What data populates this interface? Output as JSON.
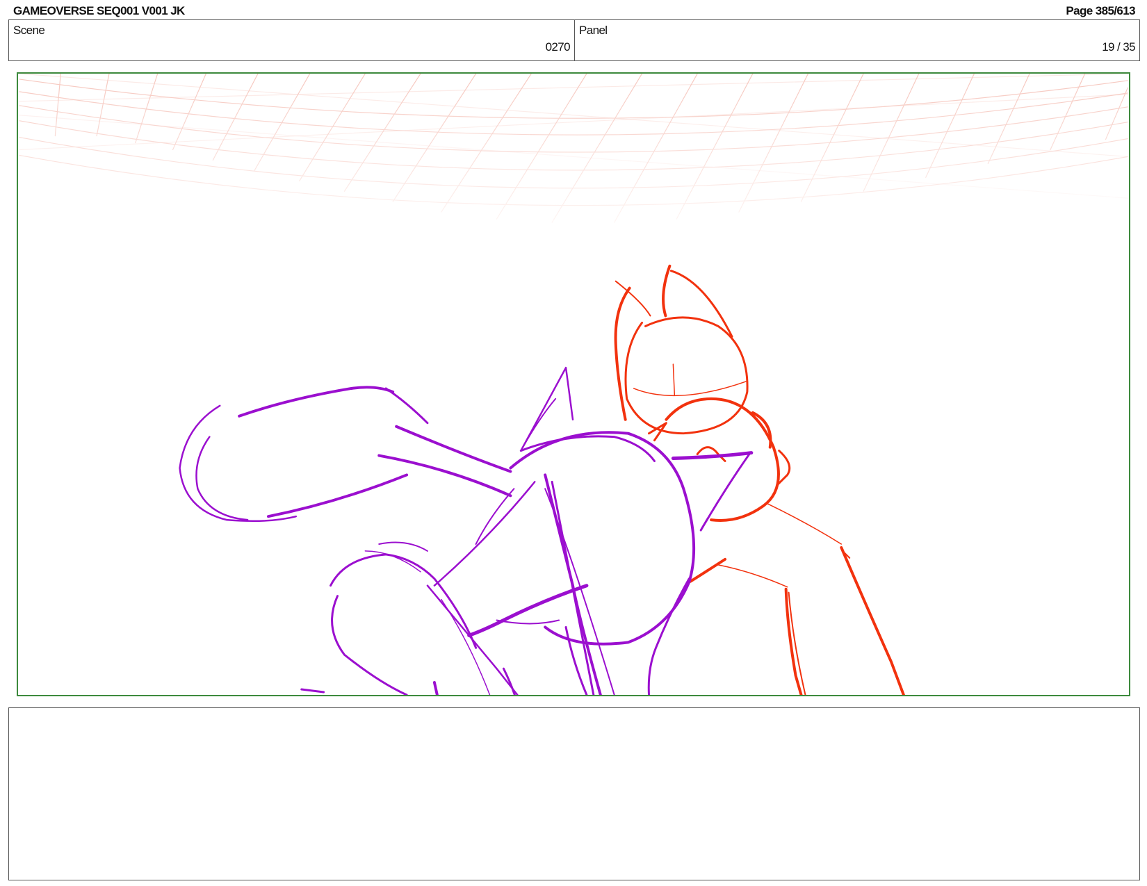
{
  "header": {
    "title": "GAMEOVERSE SEQ001 V001 JK",
    "page": "Page 385/613"
  },
  "info": {
    "scene_label": "Scene",
    "scene_value": "0270",
    "panel_label": "Panel",
    "panel_value": "19 / 35"
  },
  "colors": {
    "frame_border": "#3d8a3d",
    "sketch_purple": "#9b0fcf",
    "sketch_red": "#f2320e",
    "grid_pink": "#f3b4a8"
  },
  "notes": {
    "text": ""
  }
}
